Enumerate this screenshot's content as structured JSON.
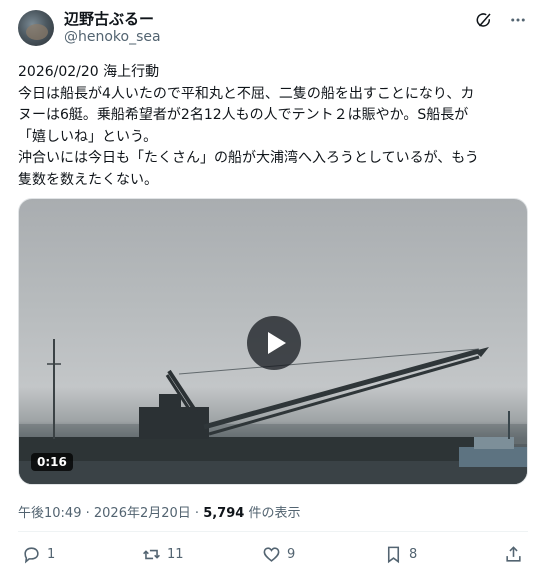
{
  "author": {
    "display_name": "辺野古ぶるー",
    "handle": "@henoko_sea"
  },
  "header_icons": [
    "grok-icon",
    "more-icon"
  ],
  "tweet": {
    "lines": [
      "2026/02/20 海上行動",
      "今日は船長が4人いたので平和丸と不屈、二隻の船を出すことになり、カ",
      "ヌーは6艇。乗船希望者が2名12人もの人でテント２は賑やか。S船長が",
      "「嬉しいね」という。",
      "沖合いには今日も「たくさん」の船が大浦湾へ入ろうとしているが、もう",
      "隻数を数えたくない。"
    ]
  },
  "media": {
    "duration": "0:16"
  },
  "meta": {
    "time": "午後10:49",
    "separator": " · ",
    "date": "2026年2月20日",
    "views_count": "5,794",
    "views_label": " 件の表示"
  },
  "actions": {
    "replies": "1",
    "reposts": "11",
    "likes": "9",
    "bookmarks": "8"
  },
  "colors": {
    "text": "#0f1419",
    "secondary": "#536471"
  }
}
